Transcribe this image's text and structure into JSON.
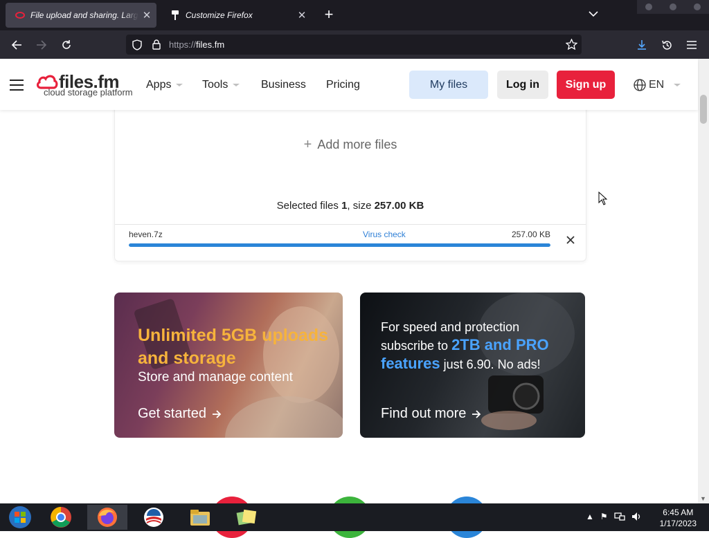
{
  "browser": {
    "tabs": [
      {
        "title": "File upload and sharing. Large files",
        "active": true
      },
      {
        "title": "Customize Firefox",
        "active": false
      }
    ],
    "url_scheme": "https://",
    "url_host": "files.fm"
  },
  "site": {
    "logo": {
      "brand": "files.fm",
      "tagline": "cloud storage platform"
    },
    "nav": [
      "Apps",
      "Tools",
      "Business",
      "Pricing"
    ],
    "buttons": {
      "my_files": "My files",
      "log_in": "Log in",
      "sign_up": "Sign up"
    },
    "language": "EN"
  },
  "upload": {
    "add_more": "Add more files",
    "selected_label": "Selected files ",
    "selected_count": "1",
    "size_label": ", size ",
    "total_size": "257.00 KB",
    "file": {
      "name": "heven.7z",
      "status": "Virus check",
      "size": "257.00 KB",
      "progress": 1.0
    }
  },
  "promos": [
    {
      "headline": "Unlimited 5GB uploads and storage",
      "sub": "Store and manage content",
      "cta": "Get started"
    },
    {
      "line_a": "For speed and protection subscribe to ",
      "highlight": "2TB and PRO features",
      "line_b": " just 6.90. No ads!",
      "cta": "Find out more"
    }
  ],
  "taskbar": {
    "time": "6:45 AM",
    "date": "1/17/2023"
  },
  "colors": {
    "accent_red": "#e8213c",
    "progress_blue": "#2a85d8",
    "promo_orange": "#f6b33c",
    "promo_blue": "#4aa3ff"
  }
}
